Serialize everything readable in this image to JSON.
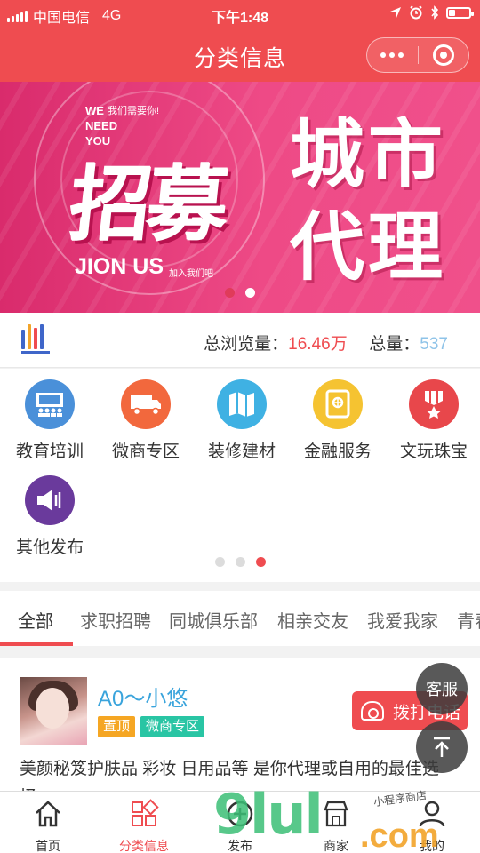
{
  "status": {
    "carrier": "中国电信",
    "network": "4G",
    "time": "下午1:48"
  },
  "nav": {
    "title": "分类信息"
  },
  "banner": {
    "small_en": "WE\nNEED\nYOU",
    "small_cn": "我们需要你!",
    "headline": "招募",
    "join_en": "JION US",
    "join_cn": "加入我们吧",
    "right_title": "城市\n代理",
    "slide_index": 2,
    "slide_count": 2
  },
  "stats": {
    "views_label": "总浏览量：",
    "views_value": "16.46万",
    "total_label": "总量：",
    "total_value": "537"
  },
  "categories": [
    {
      "label": "教育培训",
      "icon": "classroom-icon",
      "color": "#4a90d9"
    },
    {
      "label": "微商专区",
      "icon": "truck-icon",
      "color": "#f2683d"
    },
    {
      "label": "装修建材",
      "icon": "map-icon",
      "color": "#3fb1e3"
    },
    {
      "label": "金融服务",
      "icon": "safe-icon",
      "color": "#f5c331"
    },
    {
      "label": "文玩珠宝",
      "icon": "medal-icon",
      "color": "#e8474b"
    },
    {
      "label": "其他发布",
      "icon": "speaker-icon",
      "color": "#6a3a9c"
    }
  ],
  "category_pages": {
    "current": 3,
    "count": 3
  },
  "tabs": [
    "全部",
    "求职招聘",
    "同城俱乐部",
    "相亲交友",
    "我爱我家",
    "青春"
  ],
  "post": {
    "name": "A0～小悠",
    "tags": [
      {
        "label": "置顶",
        "color": "#f5a623"
      },
      {
        "label": "微商专区",
        "color": "#29c5a4"
      }
    ],
    "desc": "美颜秘笈护肤品 彩妆 日用品等 是你代理或自用的最佳选",
    "desc2": "择"
  },
  "float": {
    "kefu": "客服",
    "call": "拨打电话"
  },
  "tabbar": [
    {
      "label": "首页",
      "icon": "home-icon"
    },
    {
      "label": "分类信息",
      "icon": "category-grid-icon"
    },
    {
      "label": "发布",
      "icon": "publish-icon"
    },
    {
      "label": "商家",
      "icon": "shop-icon"
    },
    {
      "label": "我的",
      "icon": "user-icon"
    }
  ],
  "watermark": {
    "main": "9lul",
    "com": ".com",
    "handwritten": "小程序商店"
  },
  "colors": {
    "accent": "#ef4c50",
    "link": "#3aa4dc",
    "stat_blue": "#8ec3e8"
  }
}
